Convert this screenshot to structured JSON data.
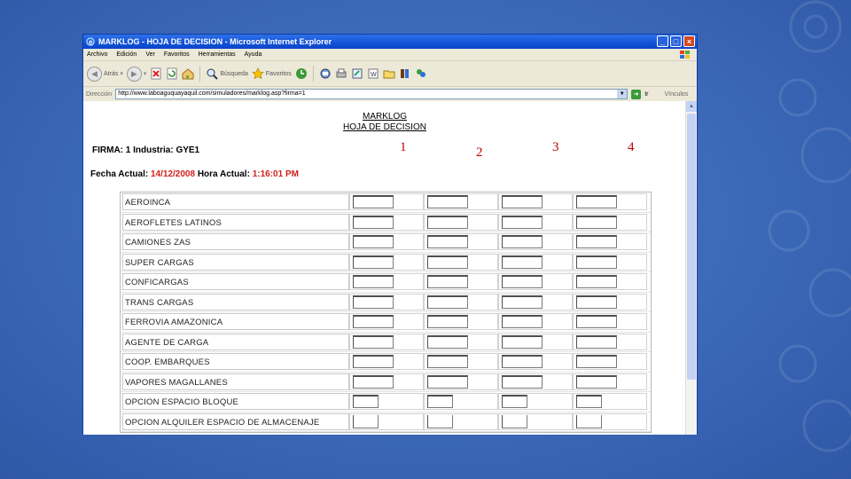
{
  "window": {
    "title": "MARKLOG - HOJA DE DECISION - Microsoft Internet Explorer",
    "controls": [
      "_",
      "□",
      "×"
    ]
  },
  "menu": [
    "Archivo",
    "Edición",
    "Ver",
    "Favoritos",
    "Herramientas",
    "Ayuda"
  ],
  "toolbar": {
    "back_label": "Atrás",
    "search_label": "Búsqueda",
    "favorites_label": "Favoritos"
  },
  "address": {
    "label": "Dirección",
    "url": "http://www.laboaguquayaquil.com/simuladores/marklog.asp?firma=1",
    "go_label": "Ir",
    "links_label": "Vínculos"
  },
  "page": {
    "title": "MARKLOG",
    "subtitle": "HOJA DE DECISION",
    "firma_text": "FIRMA: 1 Industria: GYE1",
    "fecha_label": "Fecha Actual:",
    "fecha_value": "14/12/2008",
    "hora_label": "Hora Actual:",
    "hora_value": "1:16:01 PM"
  },
  "column_numbers": [
    "1",
    "2",
    "3",
    "4"
  ],
  "rows": [
    {
      "label": "AEROINCA",
      "small": false
    },
    {
      "label": "AEROFLETES LATINOS",
      "small": false
    },
    {
      "label": "CAMIONES ZAS",
      "small": false
    },
    {
      "label": "SUPER CARGAS",
      "small": false
    },
    {
      "label": "CONFICARGAS",
      "small": false
    },
    {
      "label": "TRANS CARGAS",
      "small": false
    },
    {
      "label": "FERROVIA AMAZONICA",
      "small": false
    },
    {
      "label": "AGENTE DE CARGA",
      "small": false
    },
    {
      "label": "COOP. EMBARQUES",
      "small": false
    },
    {
      "label": "VAPORES MAGALLANES",
      "small": false
    },
    {
      "label": "OPCION ESPACIO BLOQUE",
      "small": true
    },
    {
      "label": "OPCION ALQUILER ESPACIO DE ALMACENAJE",
      "small": true
    }
  ],
  "colors": {
    "accent_red": "#d0201c",
    "titlebar_blue": "#1151d8",
    "slide_background": "#3c68b8"
  },
  "icons": [
    "ie-icon",
    "windows-flag-icon",
    "back-icon",
    "forward-icon",
    "stop-icon",
    "refresh-icon",
    "home-icon",
    "search-icon",
    "favorites-star-icon",
    "history-icon",
    "mail-icon",
    "print-icon",
    "edit-icon",
    "folder-icon",
    "messenger-icon",
    "go-icon"
  ]
}
